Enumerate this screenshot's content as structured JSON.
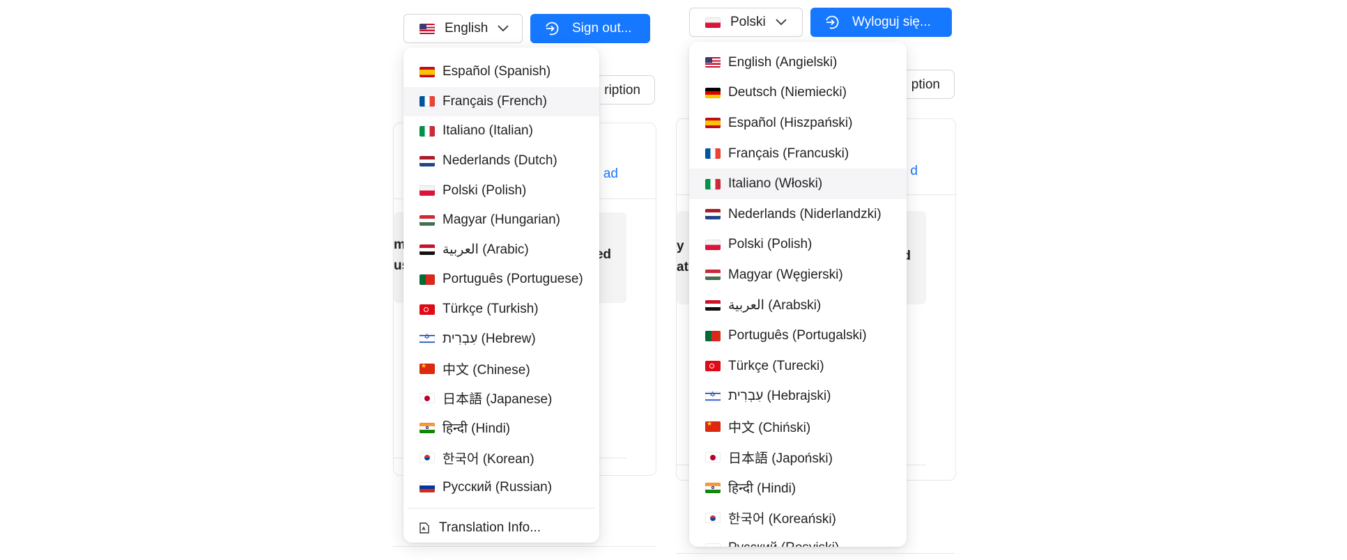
{
  "left": {
    "language_select": {
      "flag": "us",
      "label": "English"
    },
    "signout_label": "Sign out...",
    "background": {
      "button_text": "ription",
      "link_text": "ad",
      "table_text_left_1": "me",
      "table_text_left_2": "us",
      "table_text_right": "ed"
    },
    "menu": [
      {
        "flag": "es",
        "label": "Español (Spanish)"
      },
      {
        "flag": "fr",
        "label": "Français (French)"
      },
      {
        "flag": "it",
        "label": "Italiano (Italian)"
      },
      {
        "flag": "nl",
        "label": "Nederlands (Dutch)"
      },
      {
        "flag": "pl",
        "label": "Polski (Polish)"
      },
      {
        "flag": "hu",
        "label": "Magyar (Hungarian)"
      },
      {
        "flag": "eg",
        "label": "العربية (Arabic)"
      },
      {
        "flag": "pt",
        "label": "Português (Portuguese)"
      },
      {
        "flag": "tr",
        "label": "Türkçe (Turkish)"
      },
      {
        "flag": "il",
        "label": "עִבְרִית (Hebrew)"
      },
      {
        "flag": "cn",
        "label": "中文 (Chinese)"
      },
      {
        "flag": "jp",
        "label": "日本語 (Japanese)"
      },
      {
        "flag": "in",
        "label": "हिन्दी (Hindi)"
      },
      {
        "flag": "kr",
        "label": "한국어 (Korean)"
      },
      {
        "flag": "ru",
        "label": "Русский (Russian)"
      }
    ],
    "hovered_item": "Français (French)",
    "footer_label": "Translation Info..."
  },
  "right": {
    "language_select": {
      "flag": "pl",
      "label": "Polski"
    },
    "signout_label": "Wyloguj się...",
    "background": {
      "button_text": "ption",
      "link_text": "d",
      "table_text_left_1": "y",
      "table_text_left_2": "at",
      "table_text_right": "d"
    },
    "menu": [
      {
        "flag": "us",
        "label": "English (Angielski)"
      },
      {
        "flag": "de",
        "label": "Deutsch (Niemiecki)"
      },
      {
        "flag": "es",
        "label": "Español (Hiszpański)"
      },
      {
        "flag": "fr",
        "label": "Français (Francuski)"
      },
      {
        "flag": "it",
        "label": "Italiano (Włoski)"
      },
      {
        "flag": "nl",
        "label": "Nederlands (Niderlandzki)"
      },
      {
        "flag": "pl",
        "label": "Polski (Polish)"
      },
      {
        "flag": "hu",
        "label": "Magyar (Węgierski)"
      },
      {
        "flag": "eg",
        "label": "العربية (Arabski)"
      },
      {
        "flag": "pt",
        "label": "Português (Portugalski)"
      },
      {
        "flag": "tr",
        "label": "Türkçe (Turecki)"
      },
      {
        "flag": "il",
        "label": "עִבְרִית (Hebrajski)"
      },
      {
        "flag": "cn",
        "label": "中文 (Chiński)"
      },
      {
        "flag": "jp",
        "label": "日本語 (Japoński)"
      },
      {
        "flag": "in",
        "label": "हिन्दी (Hindi)"
      },
      {
        "flag": "kr",
        "label": "한국어 (Koreański)"
      },
      {
        "flag": "ru",
        "label": "Русский (Rosyjski)"
      }
    ],
    "hovered_item": "Italiano (Włoski)"
  },
  "colors": {
    "accent": "#1677ff",
    "hover": "#f5f5f7",
    "border": "#d4d4d8"
  },
  "icons": {
    "chevron": "chevron-down-icon",
    "signout": "sign-out-icon",
    "translation_info": "translation-info-icon"
  }
}
